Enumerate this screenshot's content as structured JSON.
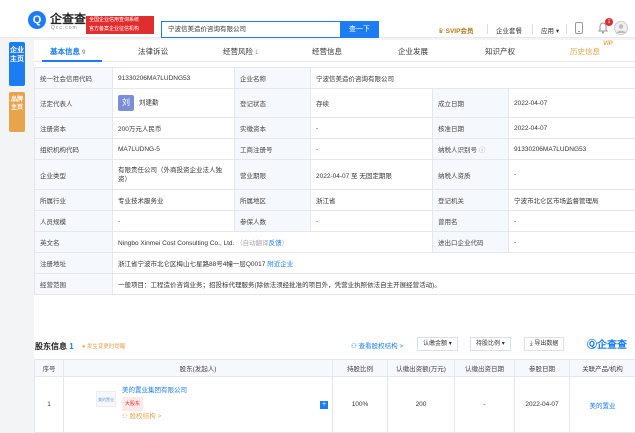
{
  "header": {
    "brand": "企查查",
    "brand_sub": "Qcc.com",
    "official_line1": "全国企业信用查询系统",
    "official_line2": "官方备案企业征信机构",
    "search_value": "宁波信美造价咨询有限公司",
    "search_button": "查一下",
    "svip_label": "SVIP会员",
    "nav": [
      "企业套餐",
      "应用"
    ],
    "notification_count": "1"
  },
  "sidebar": {
    "tab1": "企业主页",
    "tab2": "品牌主页"
  },
  "tabs": [
    {
      "label": "基本信息",
      "count": "9"
    },
    {
      "label": "法律诉讼",
      "count": ""
    },
    {
      "label": "经营风险",
      "count": "1"
    },
    {
      "label": "经营信息",
      "count": ""
    },
    {
      "label": "企业发展",
      "count": ""
    },
    {
      "label": "知识产权",
      "count": ""
    },
    {
      "label": "历史信息",
      "count": ""
    }
  ],
  "vip_tag": "VIP",
  "info": {
    "credit_code_label": "统一社会信用代码",
    "credit_code": "91330206MA7LUDNG53",
    "company_name_label": "企业名称",
    "company_name": "宁波信美造价咨询有限公司",
    "legal_rep_label": "法定代表人",
    "legal_rep_avatar": "刘",
    "legal_rep": "刘建勤",
    "reg_status_label": "登记状态",
    "reg_status": "存续",
    "est_date_label": "成立日期",
    "est_date": "2022-04-07",
    "reg_capital_label": "注册资本",
    "reg_capital": "200万元人民币",
    "paid_capital_label": "实缴资本",
    "paid_capital": "-",
    "approve_date_label": "核准日期",
    "approve_date": "2022-04-07",
    "org_code_label": "组织机构代码",
    "org_code": "MA7LUDNG-5",
    "biz_reg_no_label": "工商注册号",
    "biz_reg_no": "-",
    "taxpayer_id_label": "纳税人识别号",
    "taxpayer_id": "91330206MA7LUDNG53",
    "company_type_label": "企业类型",
    "company_type_line1": "有限责任公司（外商投资企业法人独",
    "company_type_line2": "资）",
    "biz_term_label": "营业期限",
    "biz_term": "2022-04-07 至 无固定期限",
    "taxpayer_qual_label": "纳税人资质",
    "taxpayer_qual": "-",
    "industry_label": "所属行业",
    "industry": "专业技术服务业",
    "region_label": "所属地区",
    "region": "浙江省",
    "reg_authority_label": "登记机关",
    "reg_authority": "宁波市北仑区市场监督管理局",
    "staff_size_label": "人员规模",
    "staff_size": "-",
    "insured_label": "参保人数",
    "insured": "-",
    "former_name_label": "曾用名",
    "former_name": "-",
    "english_name_label": "英文名",
    "english_name": "Ningbo Xinmei Cost Consulting Co., Ltd.",
    "english_note": "（自动翻译",
    "english_feedback": "反馈",
    "english_close": "）",
    "import_export_label": "进出口企业代码",
    "import_export": "-",
    "address_label": "注册地址",
    "address": "浙江省宁波市北仑区梅山七星路88号4幢一层Q0017",
    "nearby_link": "附近企业",
    "scope_label": "经营范围",
    "scope": "一般项目：工程造价咨询业务；招投标代理服务(除依法须经批准的项目外，凭营业执照依法自主开展经营活动)。"
  },
  "shareholders": {
    "title": "股东信息",
    "count": "1",
    "note": "发生变更时提醒",
    "equity_link": "查看股权结构 >",
    "amount_filter": "认缴金额",
    "ratio_filter": "持股比例",
    "export_button": "导出数据",
    "brand": "企查查",
    "columns": [
      "序号",
      "股东(发起人)",
      "持股比例",
      "认缴出资额(万元)",
      "认缴出资日期",
      "参股日期",
      "关联产品/机构"
    ],
    "rows": [
      {
        "index": "1",
        "name": "美的置业集团有限公司",
        "tag": "大股东",
        "equity_link": "股权结构 >",
        "ratio": "100%",
        "amount": "200",
        "sub_date": "-",
        "join_date": "2022-04-07",
        "product": "美的置业"
      }
    ]
  }
}
